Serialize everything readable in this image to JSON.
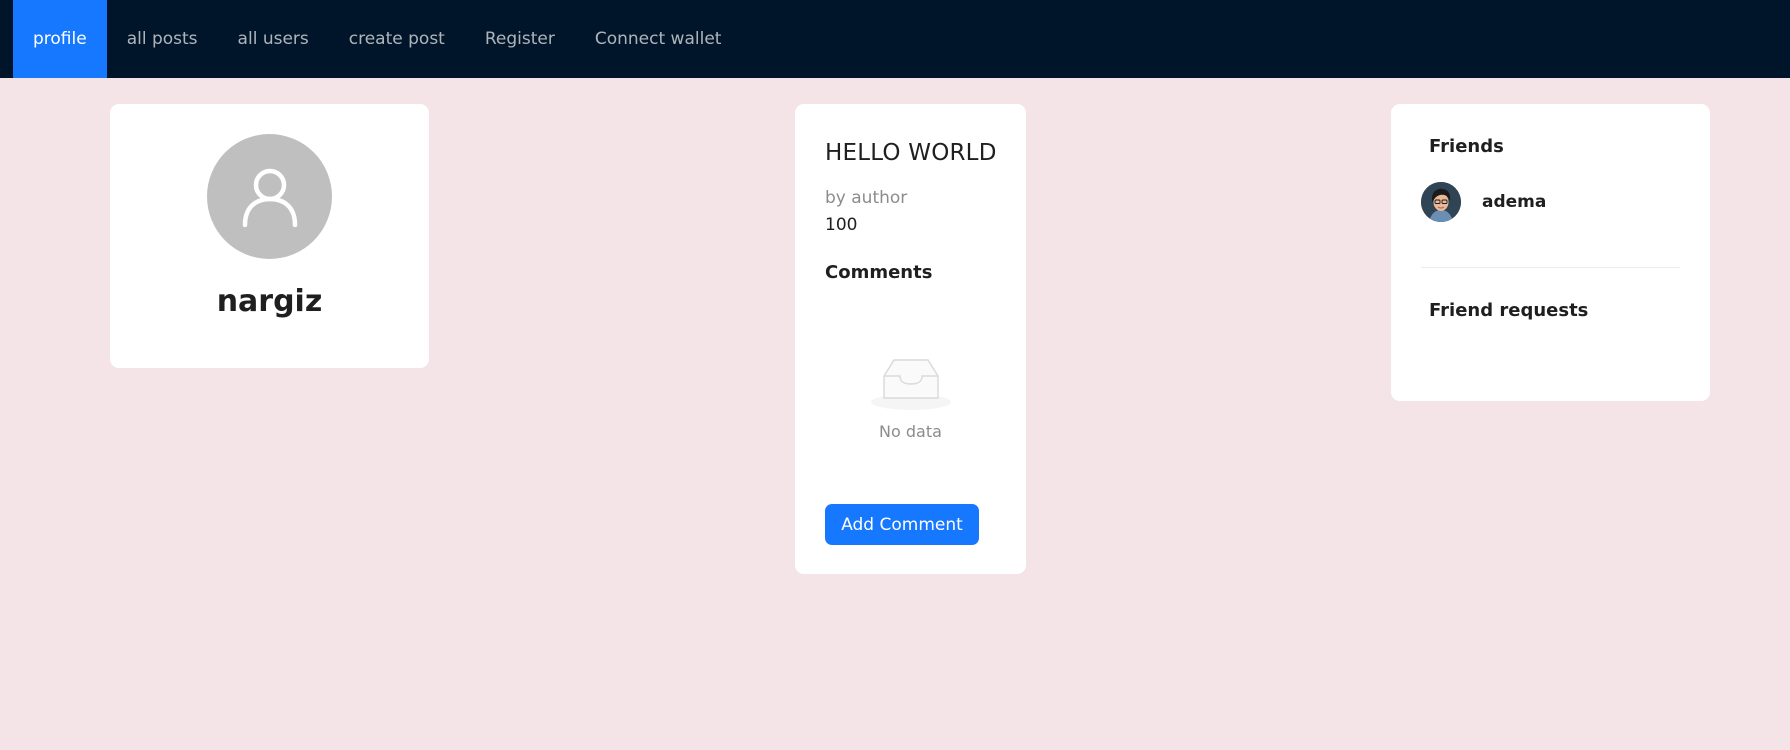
{
  "nav": {
    "items": [
      {
        "label": "profile",
        "active": true
      },
      {
        "label": "all posts"
      },
      {
        "label": "all users"
      },
      {
        "label": "create post"
      },
      {
        "label": "Register"
      },
      {
        "label": "Connect wallet"
      }
    ]
  },
  "profile": {
    "avatar_icon": "user-icon",
    "name": "nargiz"
  },
  "post": {
    "title": "HELLO WORLD",
    "author": "by author",
    "value": "100",
    "comments_heading": "Comments",
    "empty_icon": "inbox-icon",
    "empty_text": "No data",
    "add_comment_label": "Add Comment"
  },
  "friends": {
    "heading": "Friends",
    "list": [
      {
        "name": "adema"
      }
    ],
    "requests_heading": "Friend requests"
  },
  "colors": {
    "nav_bg": "#001529",
    "accent": "#1677ff",
    "page_bg": "#f4e4e8"
  }
}
